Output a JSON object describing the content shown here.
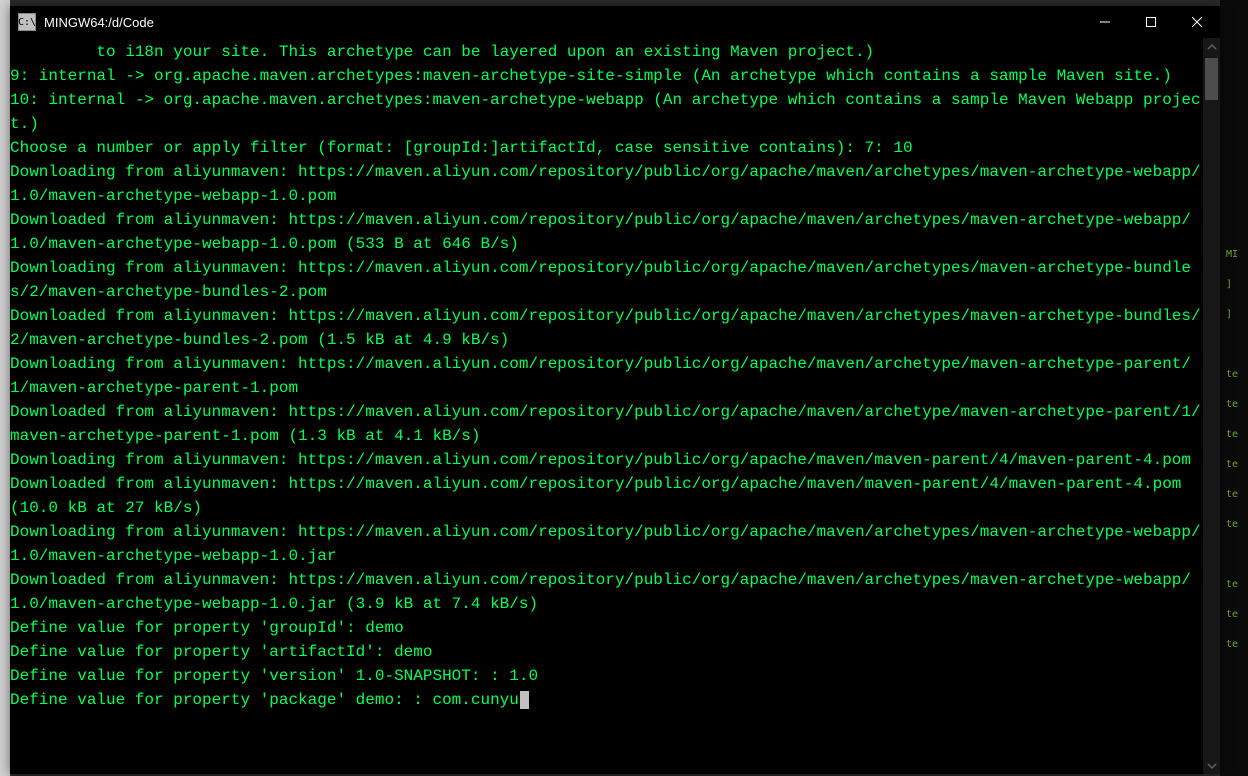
{
  "titlebar": {
    "icon_text": "C:\\",
    "title": "MINGW64:/d/Code"
  },
  "terminal": {
    "lines": [
      "         to i18n your site. This archetype can be layered upon an existing Maven project.)",
      "9: internal -> org.apache.maven.archetypes:maven-archetype-site-simple (An archetype which contains a sample Maven site.)",
      "10: internal -> org.apache.maven.archetypes:maven-archetype-webapp (An archetype which contains a sample Maven Webapp project.)",
      "Choose a number or apply filter (format: [groupId:]artifactId, case sensitive contains): 7: 10",
      "Downloading from aliyunmaven: https://maven.aliyun.com/repository/public/org/apache/maven/archetypes/maven-archetype-webapp/1.0/maven-archetype-webapp-1.0.pom",
      "Downloaded from aliyunmaven: https://maven.aliyun.com/repository/public/org/apache/maven/archetypes/maven-archetype-webapp/1.0/maven-archetype-webapp-1.0.pom (533 B at 646 B/s)",
      "Downloading from aliyunmaven: https://maven.aliyun.com/repository/public/org/apache/maven/archetypes/maven-archetype-bundles/2/maven-archetype-bundles-2.pom",
      "Downloaded from aliyunmaven: https://maven.aliyun.com/repository/public/org/apache/maven/archetypes/maven-archetype-bundles/2/maven-archetype-bundles-2.pom (1.5 kB at 4.9 kB/s)",
      "Downloading from aliyunmaven: https://maven.aliyun.com/repository/public/org/apache/maven/archetype/maven-archetype-parent/1/maven-archetype-parent-1.pom",
      "Downloaded from aliyunmaven: https://maven.aliyun.com/repository/public/org/apache/maven/archetype/maven-archetype-parent/1/maven-archetype-parent-1.pom (1.3 kB at 4.1 kB/s)",
      "Downloading from aliyunmaven: https://maven.aliyun.com/repository/public/org/apache/maven/maven-parent/4/maven-parent-4.pom",
      "Downloaded from aliyunmaven: https://maven.aliyun.com/repository/public/org/apache/maven/maven-parent/4/maven-parent-4.pom (10.0 kB at 27 kB/s)",
      "Downloading from aliyunmaven: https://maven.aliyun.com/repository/public/org/apache/maven/archetypes/maven-archetype-webapp/1.0/maven-archetype-webapp-1.0.jar",
      "Downloaded from aliyunmaven: https://maven.aliyun.com/repository/public/org/apache/maven/archetypes/maven-archetype-webapp/1.0/maven-archetype-webapp-1.0.jar (3.9 kB at 7.4 kB/s)",
      "Define value for property 'groupId': demo",
      "Define value for property 'artifactId': demo",
      "Define value for property 'version' 1.0-SNAPSHOT: : 1.0",
      "Define value for property 'package' demo: : com.cunyu"
    ]
  },
  "background": {
    "right_hint": "MI\n]\n]\n\nte\nte\nte\nte\nte\nte\n\nte\nte\nte"
  }
}
